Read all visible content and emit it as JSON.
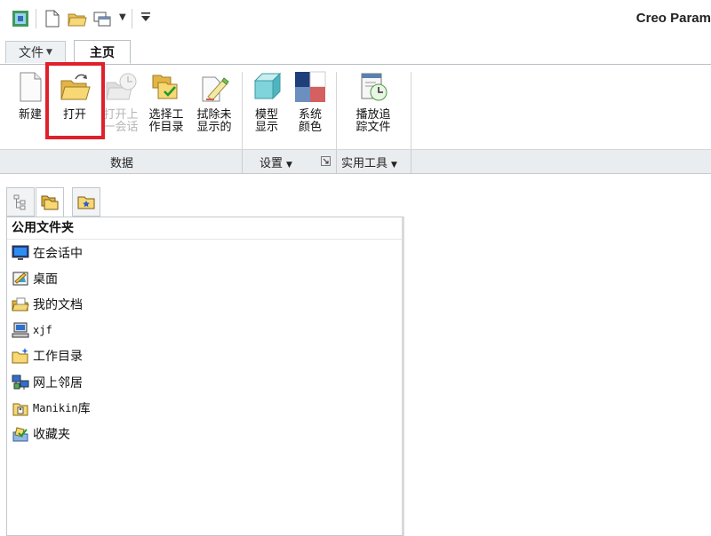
{
  "app": {
    "title": "Creo Param"
  },
  "tabs": {
    "file": "文件",
    "home": "主页"
  },
  "ribbon": {
    "buttons": [
      {
        "label": "新建",
        "enabled": true
      },
      {
        "label": "打开",
        "enabled": true,
        "highlighted": true
      },
      {
        "label": "打开上\n一会话",
        "enabled": false
      },
      {
        "label": "选择工\n作目录",
        "enabled": true
      },
      {
        "label": "拭除未\n显示的",
        "enabled": true
      },
      {
        "label": "模型\n显示",
        "enabled": true
      },
      {
        "label": "系统\n颜色",
        "enabled": true
      },
      {
        "label": "播放追\n踪文件",
        "enabled": true
      }
    ],
    "groups": {
      "data": "数据",
      "settings": "设置",
      "utilities": "实用工具"
    }
  },
  "navigator": {
    "header": "公用文件夹",
    "items": [
      {
        "label": "在会话中",
        "icon": "monitor-icon"
      },
      {
        "label": "桌面",
        "icon": "desktop-icon"
      },
      {
        "label": "我的文档",
        "icon": "my-documents-icon"
      },
      {
        "label": "xjf",
        "icon": "computer-icon"
      },
      {
        "label": "工作目录",
        "icon": "working-directory-icon"
      },
      {
        "label": "网上邻居",
        "icon": "network-icon"
      },
      {
        "label_mono": "Manikin",
        "label_rest": " 库",
        "icon": "library-folder-icon"
      },
      {
        "label": "收藏夹",
        "icon": "favorites-icon"
      }
    ]
  },
  "colors": {
    "highlight": "#e0202a",
    "folder": "#f2c94c",
    "group_bar": "#eaedf0"
  }
}
